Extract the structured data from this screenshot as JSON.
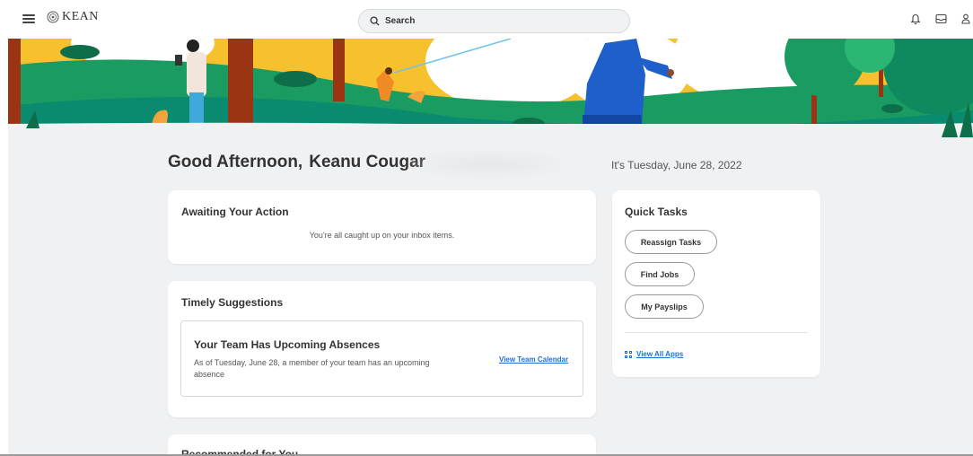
{
  "app": {
    "logo_text": "KEAN"
  },
  "search": {
    "placeholder": "Search"
  },
  "header_icons": [
    "menu-icon",
    "bell-icon",
    "inbox-icon",
    "profile-icon"
  ],
  "home": {
    "greeting": "Good Afternoon,",
    "user_name": "Keanu Cougar",
    "date_text": "It's Tuesday, June 28, 2022"
  },
  "awaiting": {
    "title": "Awaiting Your Action",
    "message": "You're all caught up on your inbox items."
  },
  "timely": {
    "title": "Timely Suggestions",
    "suggestion": {
      "title": "Your Team Has Upcoming Absences",
      "description": "As of Tuesday, June 28, a member of your team has an upcoming absence",
      "link": "View Team Calendar"
    }
  },
  "recommended": {
    "title": "Recommended for You"
  },
  "quick_tasks": {
    "title": "Quick Tasks",
    "buttons": [
      "Reassign Tasks",
      "Find Jobs",
      "My Payslips"
    ],
    "view_all": "View All Apps"
  },
  "colors": {
    "accent_link": "#1f6fd0",
    "hero_green": "#1a9b62",
    "hero_yellow": "#f7c02d",
    "hero_teal": "#0a8a6f",
    "page_bg": "#f0f1f2"
  }
}
